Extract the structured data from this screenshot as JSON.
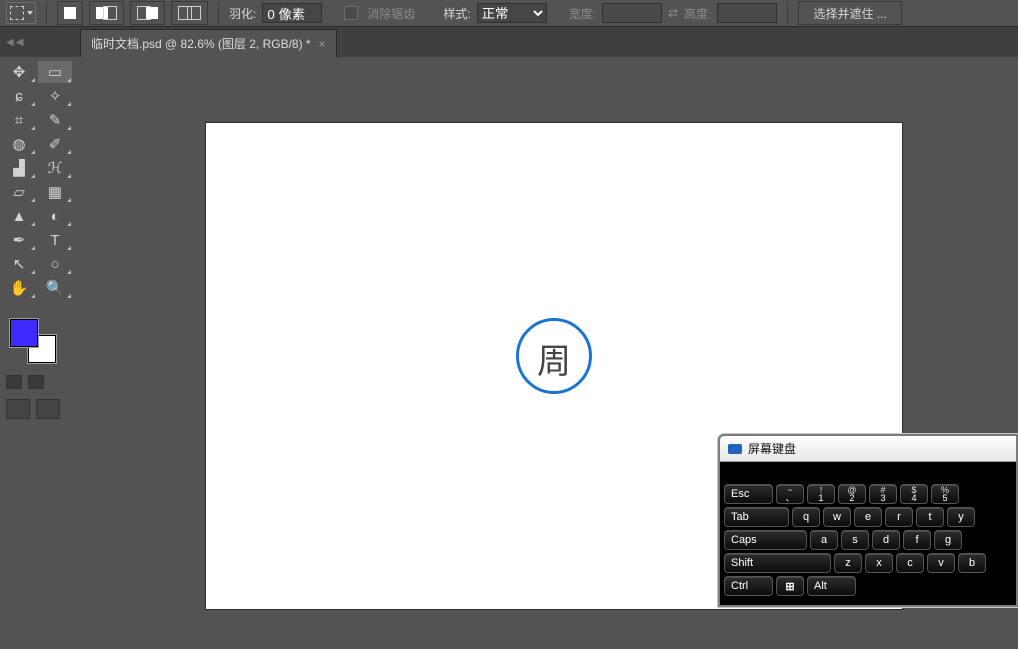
{
  "topbar": {
    "feather_label": "羽化:",
    "feather_value": "0 像素",
    "antialias_label": "消除锯齿",
    "style_label": "样式:",
    "style_value": "正常",
    "width_label": "宽度:",
    "swap_symbol": "⇄",
    "height_label": "高度:",
    "select_mask_btn": "选择并遮住 ..."
  },
  "tab": {
    "title": "临时文档.psd @ 82.6% (图层 2, RGB/8) *",
    "close": "×"
  },
  "tools": [
    {
      "name": "move-icon",
      "glyph": "✥"
    },
    {
      "name": "marquee-icon",
      "glyph": "▭",
      "sel": true
    },
    {
      "name": "lasso-icon",
      "glyph": "ɕ"
    },
    {
      "name": "magic-wand-icon",
      "glyph": "✧"
    },
    {
      "name": "crop-icon",
      "glyph": "⌗"
    },
    {
      "name": "eyedropper-icon",
      "glyph": "✎"
    },
    {
      "name": "healing-icon",
      "glyph": "◍"
    },
    {
      "name": "brush-icon",
      "glyph": "✐"
    },
    {
      "name": "stamp-icon",
      "glyph": "▟"
    },
    {
      "name": "history-brush-icon",
      "glyph": "ℋ"
    },
    {
      "name": "eraser-icon",
      "glyph": "▱"
    },
    {
      "name": "gradient-icon",
      "glyph": "▦"
    },
    {
      "name": "blur-icon",
      "glyph": "▲"
    },
    {
      "name": "dodge-icon",
      "glyph": "◐"
    },
    {
      "name": "pen-icon",
      "glyph": "✒"
    },
    {
      "name": "type-icon",
      "glyph": "T"
    },
    {
      "name": "path-select-icon",
      "glyph": "↖"
    },
    {
      "name": "shape-icon",
      "glyph": "○"
    },
    {
      "name": "hand-icon",
      "glyph": "✋"
    },
    {
      "name": "zoom-icon",
      "glyph": "🔍"
    }
  ],
  "colors": {
    "foreground": "#3e2cff",
    "background": "#ffffff"
  },
  "canvas": {
    "logo_char": "周"
  },
  "osk": {
    "title": "屏幕键盘",
    "rows": [
      [
        {
          "t": "Esc",
          "cls": "w1"
        },
        {
          "up": "~",
          "t": "、"
        },
        {
          "up": "!",
          "t": "1"
        },
        {
          "up": "@",
          "t": "2"
        },
        {
          "up": "#",
          "t": "3"
        },
        {
          "up": "$",
          "t": "4"
        },
        {
          "up": "%",
          "t": "5"
        }
      ],
      [
        {
          "t": "Tab",
          "cls": "w2"
        },
        {
          "t": "q"
        },
        {
          "t": "w"
        },
        {
          "t": "e"
        },
        {
          "t": "r"
        },
        {
          "t": "t"
        },
        {
          "t": "y"
        }
      ],
      [
        {
          "t": "Caps",
          "cls": "w3"
        },
        {
          "t": "a"
        },
        {
          "t": "s"
        },
        {
          "t": "d"
        },
        {
          "t": "f"
        },
        {
          "t": "g"
        }
      ],
      [
        {
          "t": "Shift",
          "cls": "w4"
        },
        {
          "t": "z"
        },
        {
          "t": "x"
        },
        {
          "t": "c"
        },
        {
          "t": "v"
        },
        {
          "t": "b"
        }
      ],
      [
        {
          "t": "Ctrl",
          "cls": "w1"
        },
        {
          "t": "⊞",
          "cls": "win"
        },
        {
          "t": "Alt",
          "cls": "w1"
        }
      ]
    ]
  }
}
